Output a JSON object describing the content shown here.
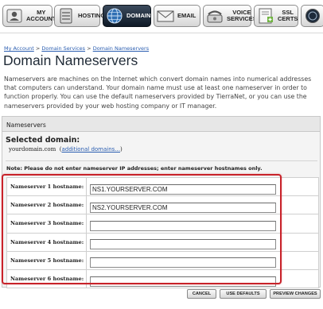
{
  "nav": {
    "items": [
      {
        "label_line1": "MY",
        "label_line2": "ACCOUNT",
        "icon": "account-icon"
      },
      {
        "label_line1": "HOSTING",
        "label_line2": "",
        "icon": "hosting-icon"
      },
      {
        "label_line1": "DOMAINS",
        "label_line2": "",
        "icon": "globe-icon",
        "active": true
      },
      {
        "label_line1": "EMAIL",
        "label_line2": "",
        "icon": "envelope-icon"
      },
      {
        "label_line1": "VOICE",
        "label_line2": "SERVICES",
        "icon": "phone-icon"
      },
      {
        "label_line1": "SSL",
        "label_line2": "CERTS",
        "icon": "certificate-icon"
      }
    ]
  },
  "breadcrumb": {
    "items": [
      "My Account",
      "Domain Services",
      "Domain Nameservers"
    ],
    "separator": ">"
  },
  "page": {
    "title": "Domain Nameservers",
    "intro": "Nameservers are machines on the Internet which convert domain names into numerical addresses that computers can understand. Your domain name must use at least one nameserver in order to function properly. You can use the default nameservers provided by TierraNet, or you can use the nameservers provided by your web hosting company or IT manager."
  },
  "panel": {
    "header": "Nameservers",
    "selected_label": "Selected domain:",
    "selected_domain": "yourdomain.com",
    "additional_link": "additional domains...",
    "note": "Note: Please do not enter nameserver IP addresses; enter nameserver hostnames only."
  },
  "nameservers": [
    {
      "label": "Nameserver 1 hostname:",
      "value": "NS1.YOURSERVER.COM"
    },
    {
      "label": "Nameserver 2 hostname:",
      "value": "NS2.YOURSERVER.COM"
    },
    {
      "label": "Nameserver 3 hostname:",
      "value": ""
    },
    {
      "label": "Nameserver 4 hostname:",
      "value": ""
    },
    {
      "label": "Nameserver 5 hostname:",
      "value": ""
    },
    {
      "label": "Nameserver 6 hostname:",
      "value": ""
    }
  ],
  "actions": {
    "cancel": "CANCEL",
    "use_defaults": "USE DEFAULTS",
    "preview": "PREVIEW CHANGES"
  },
  "colors": {
    "highlight": "#c8222a",
    "link": "#2a5db0",
    "nav_active": "#0f1a27"
  }
}
